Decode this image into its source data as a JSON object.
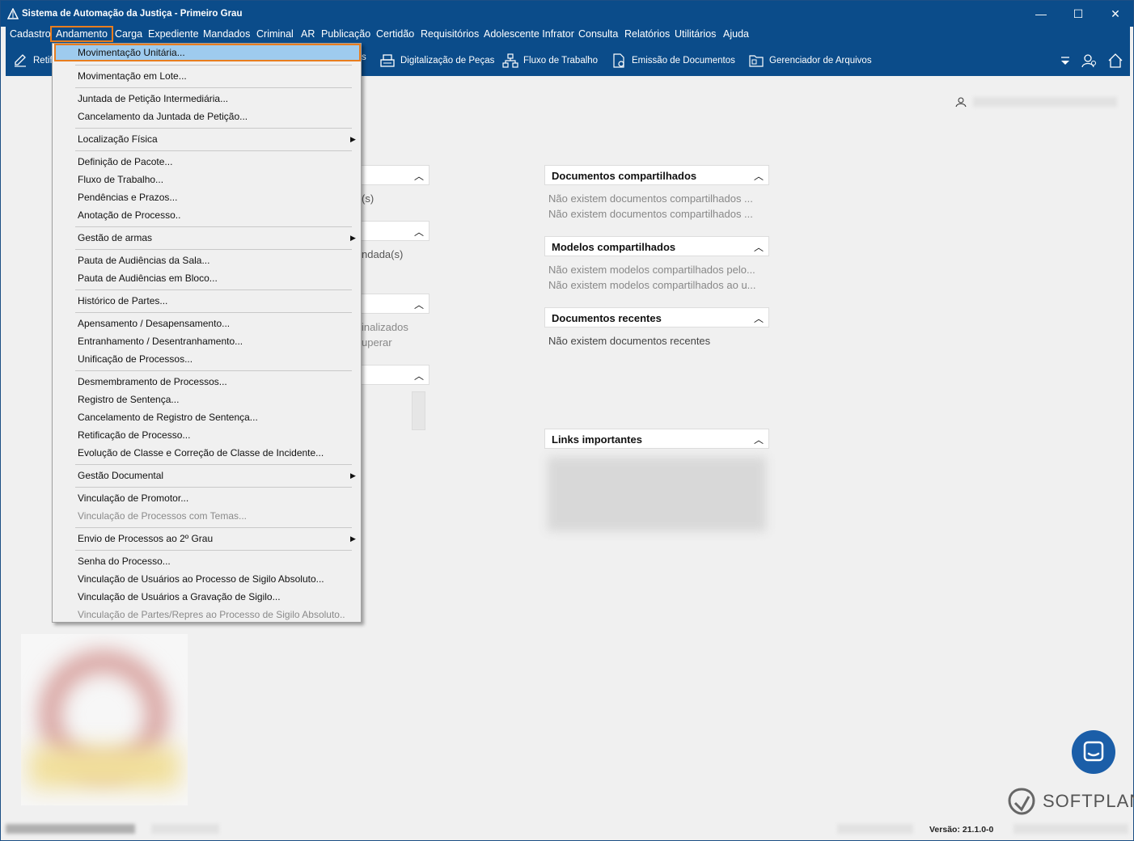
{
  "window": {
    "title": "Sistema de Automação da Justiça - Primeiro Grau",
    "controls": {
      "minimize": "—",
      "maximize": "☐",
      "close": "✕"
    }
  },
  "menubar": {
    "items": [
      "Cadastro",
      "Andamento",
      "Carga",
      "Expediente",
      "Mandados",
      "Criminal",
      "AR",
      "Publicação",
      "Certidão",
      "Requisitórios",
      "Adolescente Infrator",
      "Consulta",
      "Relatórios",
      "Utilitários",
      "Ajuda"
    ],
    "active": "Andamento"
  },
  "toolbar": {
    "left_partial": "Retif",
    "right_partial": "s",
    "items": [
      "Digitalização de Peças",
      "Fluxo de Trabalho",
      "Emissão de Documentos",
      "Gerenciador de Arquivos"
    ]
  },
  "dropdown": {
    "items": [
      {
        "label": "Movimentação Unitária...",
        "highlight": true
      },
      {
        "label": "Movimentação em Lote..."
      },
      {
        "label": "Juntada de Petição Intermediária..."
      },
      {
        "label": "Cancelamento da Juntada de Petição..."
      },
      {
        "label": "Localização Física",
        "submenu": true
      },
      {
        "label": "Definição de Pacote..."
      },
      {
        "label": "Fluxo de Trabalho..."
      },
      {
        "label": "Pendências e Prazos..."
      },
      {
        "label": "Anotação de Processo.."
      },
      {
        "label": "Gestão de armas",
        "submenu": true
      },
      {
        "label": "Pauta de Audiências da Sala..."
      },
      {
        "label": "Pauta de Audiências em Bloco..."
      },
      {
        "label": "Histórico de Partes..."
      },
      {
        "label": "Apensamento / Desapensamento..."
      },
      {
        "label": "Entranhamento / Desentranhamento..."
      },
      {
        "label": "Unificação de Processos..."
      },
      {
        "label": "Desmembramento de Processos..."
      },
      {
        "label": "Registro de Sentença..."
      },
      {
        "label": "Cancelamento de Registro de Sentença..."
      },
      {
        "label": "Retificação de Processo..."
      },
      {
        "label": "Evolução de Classe e Correção de Classe de Incidente..."
      },
      {
        "label": "Gestão Documental",
        "submenu": true
      },
      {
        "label": "Vinculação de Promotor..."
      },
      {
        "label": "Vinculação de Processos com Temas...",
        "disabled": true
      },
      {
        "label": "Envio de Processos ao 2º Grau",
        "submenu": true
      },
      {
        "label": "Senha do Processo..."
      },
      {
        "label": "Vinculação de Usuários ao Processo de Sigilo Absoluto..."
      },
      {
        "label": "Vinculação de Usuários a Gravação de Sigilo..."
      },
      {
        "label": "Vinculação de Partes/Repres ao Processo de Sigilo Absoluto..",
        "disabled": true
      }
    ]
  },
  "left_partial_texts": [
    "(s)",
    "ndada(s)",
    "inalizados",
    "uperar"
  ],
  "panels": {
    "documentos_compartilhados": {
      "title": "Documentos compartilhados",
      "lines": [
        "Não existem documentos compartilhados ...",
        "Não existem documentos compartilhados ..."
      ]
    },
    "modelos_compartilhados": {
      "title": "Modelos compartilhados",
      "lines": [
        "Não existem modelos compartilhados pelo...",
        "Não existem modelos compartilhados ao u..."
      ]
    },
    "documentos_recentes": {
      "title": "Documentos recentes",
      "lines": [
        "Não existem documentos recentes"
      ]
    },
    "links_importantes": {
      "title": "Links importantes"
    }
  },
  "brand": {
    "name": "SOFTPLAN"
  },
  "status": {
    "version": "Versão: 21.1.0-0"
  },
  "colors": {
    "accent": "#0b4c8a",
    "highlight_border": "#e87d1e",
    "highlight_fill": "#9ecbee"
  }
}
